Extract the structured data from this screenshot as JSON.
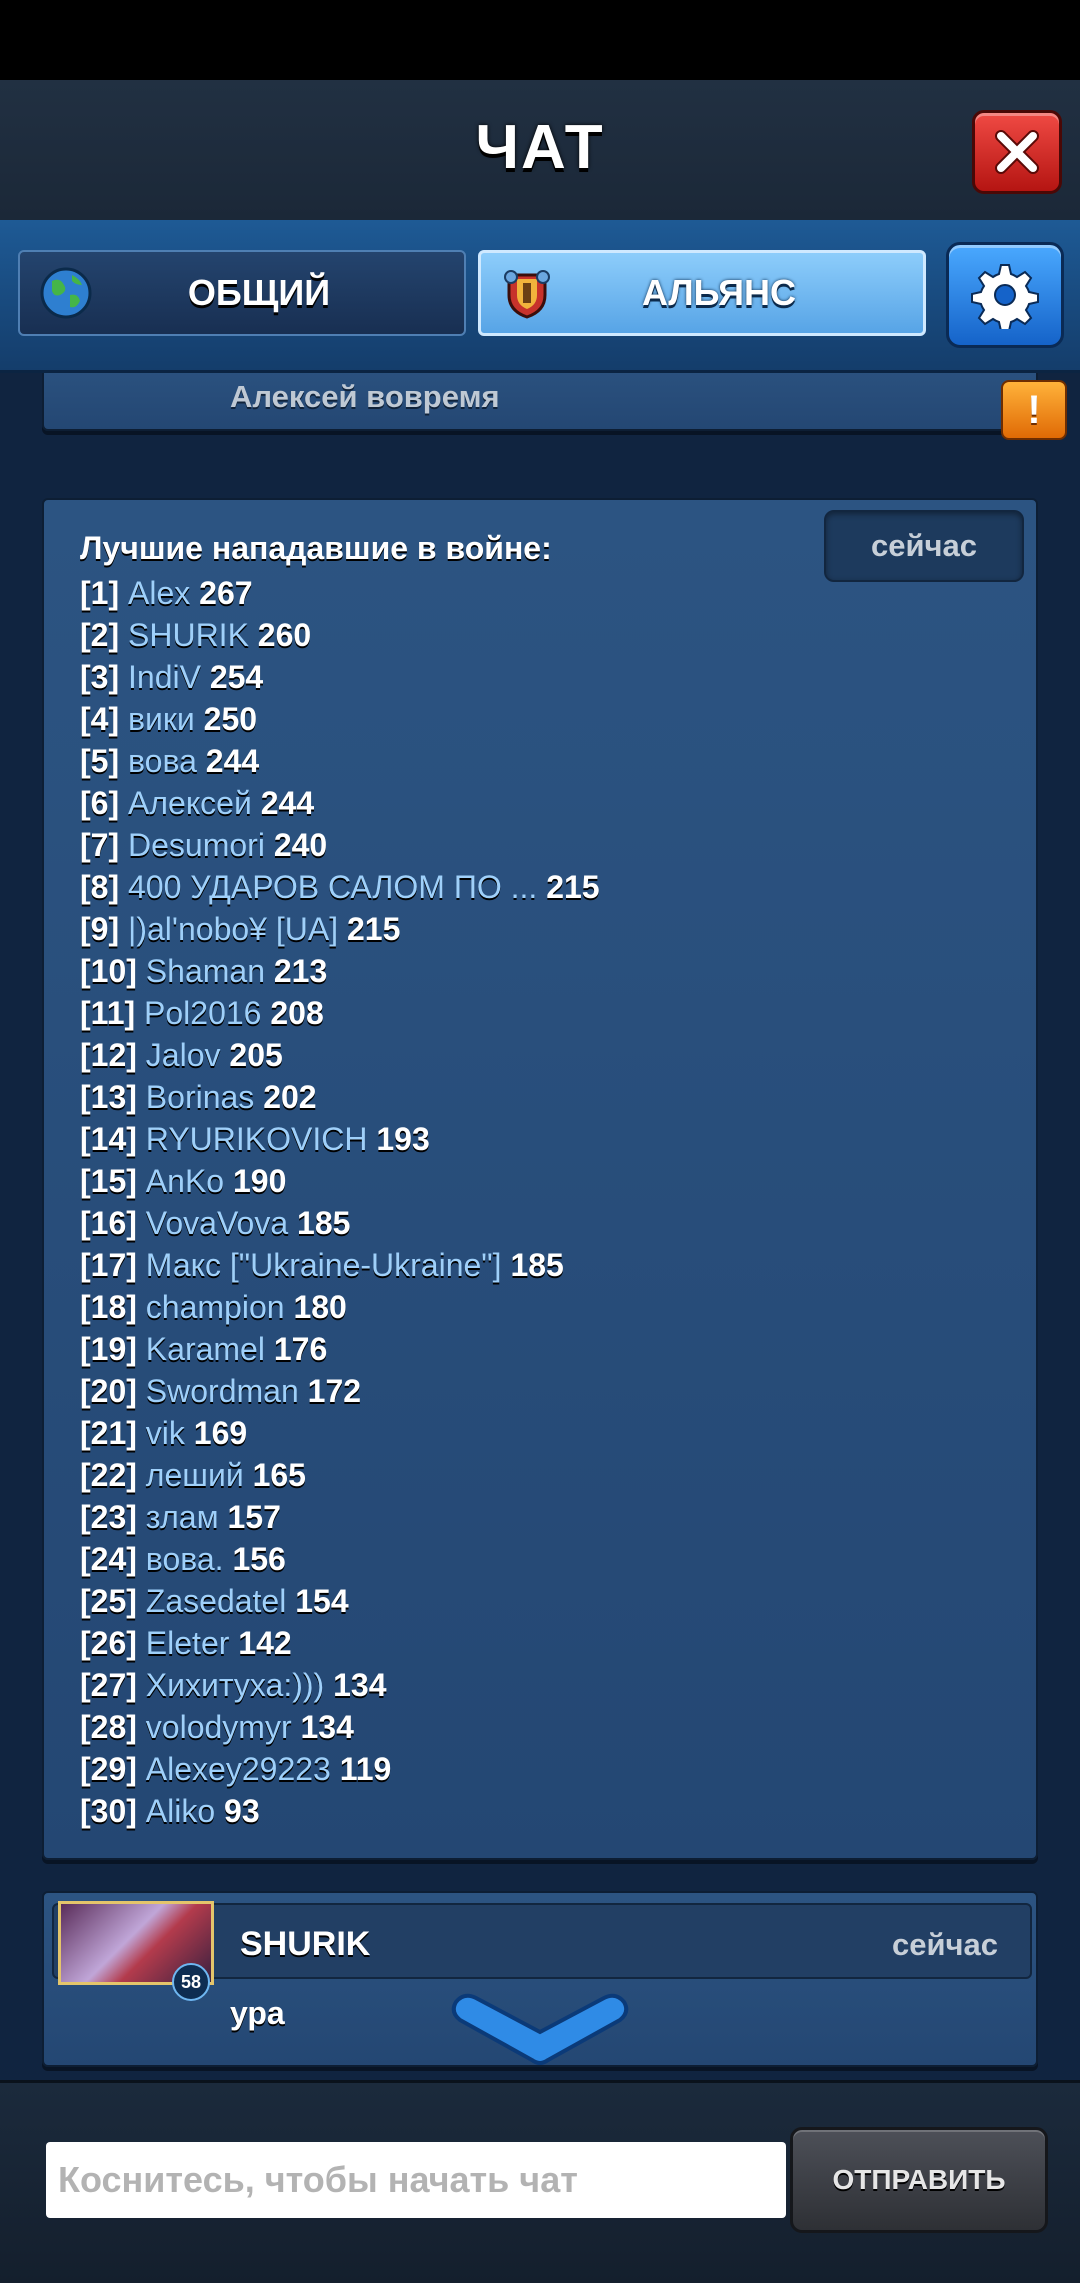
{
  "header": {
    "title": "ЧАТ",
    "close_icon": "close-icon"
  },
  "tabs": [
    {
      "label": "ОБЩИЙ",
      "icon": "globe-icon",
      "active": false
    },
    {
      "label": "АЛЬЯНС",
      "icon": "alliance-shield-icon",
      "active": true
    }
  ],
  "settings_icon": "gear-icon",
  "messages": {
    "top": {
      "text": "Алексей вовремя",
      "report_icon": "warning-icon"
    },
    "leaderboard": {
      "time": "сейчас",
      "title": "Лучшие нападавшие в войне:",
      "entries": [
        {
          "rank": "[1]",
          "name": "Alex",
          "score": "267"
        },
        {
          "rank": "[2]",
          "name": "SHURIK",
          "score": "260"
        },
        {
          "rank": "[3]",
          "name": "IndiV",
          "score": "254"
        },
        {
          "rank": "[4]",
          "name": "вики",
          "score": "250"
        },
        {
          "rank": "[5]",
          "name": "вова",
          "score": "244"
        },
        {
          "rank": "[6]",
          "name": "Алексей",
          "score": "244"
        },
        {
          "rank": "[7]",
          "name": "Desumori",
          "score": "240"
        },
        {
          "rank": "[8]",
          "name": "400 УДАРОВ САЛОМ ПО ...",
          "score": "215"
        },
        {
          "rank": "[9]",
          "name": "|)al'nobo¥ [UA]",
          "score": "215"
        },
        {
          "rank": "[10]",
          "name": "Shaman",
          "score": "213"
        },
        {
          "rank": "[11]",
          "name": "Pol2016",
          "score": "208"
        },
        {
          "rank": "[12]",
          "name": "Jalov",
          "score": "205"
        },
        {
          "rank": "[13]",
          "name": "Borinas",
          "score": "202"
        },
        {
          "rank": "[14]",
          "name": "RYURIKOVICH",
          "score": "193"
        },
        {
          "rank": "[15]",
          "name": "AnKo",
          "score": "190"
        },
        {
          "rank": "[16]",
          "name": "VovaVova",
          "score": "185"
        },
        {
          "rank": "[17]",
          "name": "Макс [\"Ukraine-Ukraine\"]",
          "score": "185"
        },
        {
          "rank": "[18]",
          "name": "champion",
          "score": "180"
        },
        {
          "rank": "[19]",
          "name": "Karamel",
          "score": "176"
        },
        {
          "rank": "[20]",
          "name": "Swordman",
          "score": "172"
        },
        {
          "rank": "[21]",
          "name": "vik",
          "score": "169"
        },
        {
          "rank": "[22]",
          "name": "леший",
          "score": "165"
        },
        {
          "rank": "[23]",
          "name": "злам",
          "score": "157"
        },
        {
          "rank": "[24]",
          "name": "вова.",
          "score": "156"
        },
        {
          "rank": "[25]",
          "name": "Zasedatel",
          "score": "154"
        },
        {
          "rank": "[26]",
          "name": "Eleter",
          "score": "142"
        },
        {
          "rank": "[27]",
          "name": "Хихитуха:)))",
          "score": "134"
        },
        {
          "rank": "[28]",
          "name": "volodymyr",
          "score": "134"
        },
        {
          "rank": "[29]",
          "name": "Alexey29223",
          "score": "119"
        },
        {
          "rank": "[30]",
          "name": "Aliko",
          "score": "93"
        }
      ]
    },
    "last": {
      "sender": "SHURIK",
      "time": "сейчас",
      "level": "58",
      "text": "ура"
    }
  },
  "scroll_icon": "chevron-down-icon",
  "input": {
    "placeholder": "Коснитесь, чтобы начать чат",
    "value": ""
  },
  "send_label": "ОТПРАВИТЬ"
}
